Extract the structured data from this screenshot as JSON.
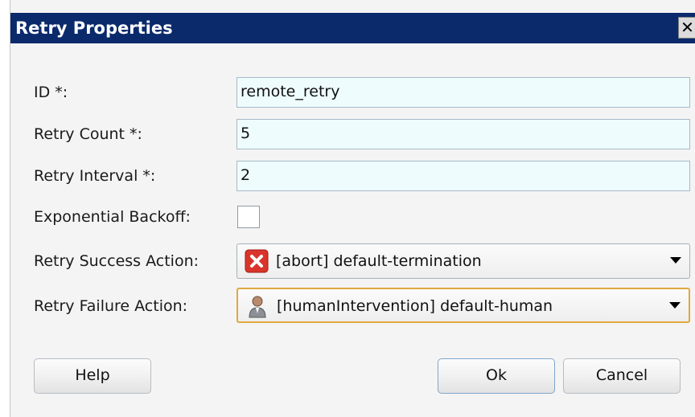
{
  "dialog": {
    "title": "Retry Properties",
    "close_glyph": "✕"
  },
  "fields": {
    "id_label": "ID *:",
    "id_value": "remote_retry",
    "retry_count_label": "Retry Count *:",
    "retry_count_value": "5",
    "retry_interval_label": "Retry Interval *:",
    "retry_interval_value": "2",
    "exponential_backoff_label": "Exponential Backoff:",
    "exponential_backoff_checked": false,
    "retry_success_label": "Retry Success Action:",
    "retry_success_value": "[abort] default-termination",
    "retry_success_icon": "abort-icon",
    "retry_failure_label": "Retry Failure Action:",
    "retry_failure_value": "[humanIntervention] default-human",
    "retry_failure_icon": "human-icon"
  },
  "buttons": {
    "help": "Help",
    "ok": "Ok",
    "cancel": "Cancel"
  },
  "colors": {
    "titlebar": "#0a2a6b",
    "field_background": "#eefcfd",
    "focus_border": "#e0a93c",
    "abort_icon": "#d9342b"
  }
}
